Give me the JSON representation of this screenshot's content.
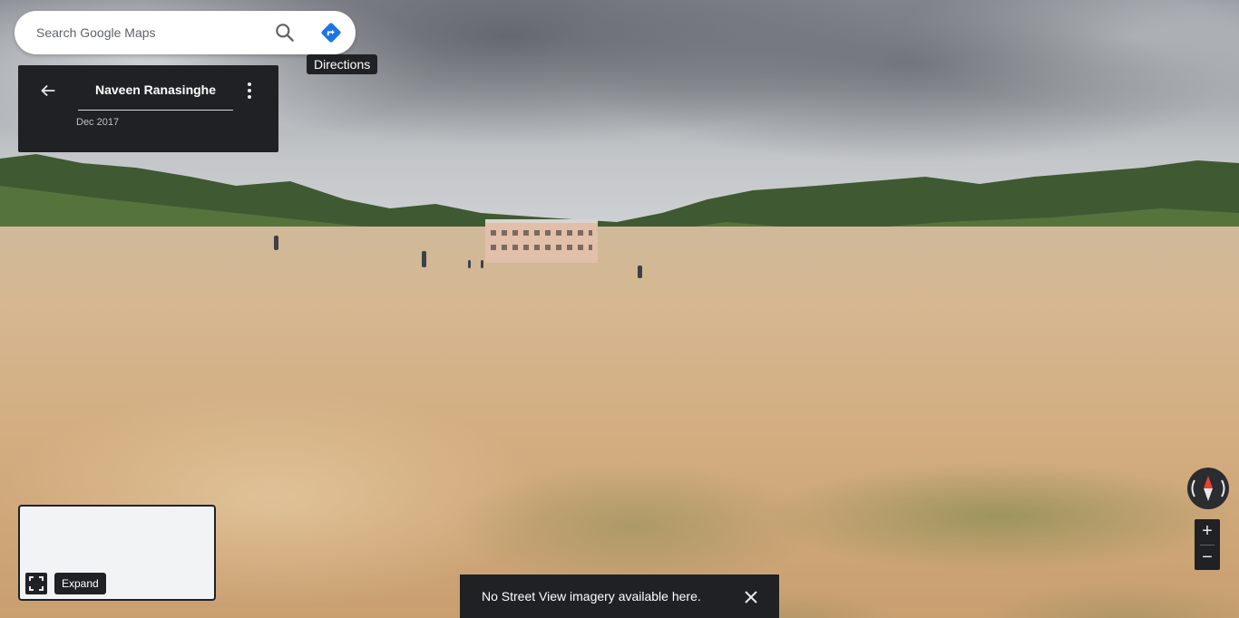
{
  "search": {
    "placeholder": "Search Google Maps",
    "search_icon": "search-icon",
    "directions_icon": "directions-icon",
    "directions_tooltip": "Directions"
  },
  "info_card": {
    "back_icon": "arrow-left-icon",
    "author": "Naveen Ranasinghe",
    "more_icon": "more-vertical-icon",
    "date": "Dec 2017"
  },
  "controls": {
    "compass_icon": "compass-icon",
    "zoom_in_label": "+",
    "zoom_out_label": "−"
  },
  "minimap": {
    "expand_icon": "expand-icon",
    "expand_tooltip": "Expand"
  },
  "toast": {
    "message": "No Street View imagery available here.",
    "close_icon": "close-icon"
  },
  "colors": {
    "panel_bg": "#202124",
    "directions_blue": "#1a73e8",
    "compass_red": "#ea4335"
  }
}
